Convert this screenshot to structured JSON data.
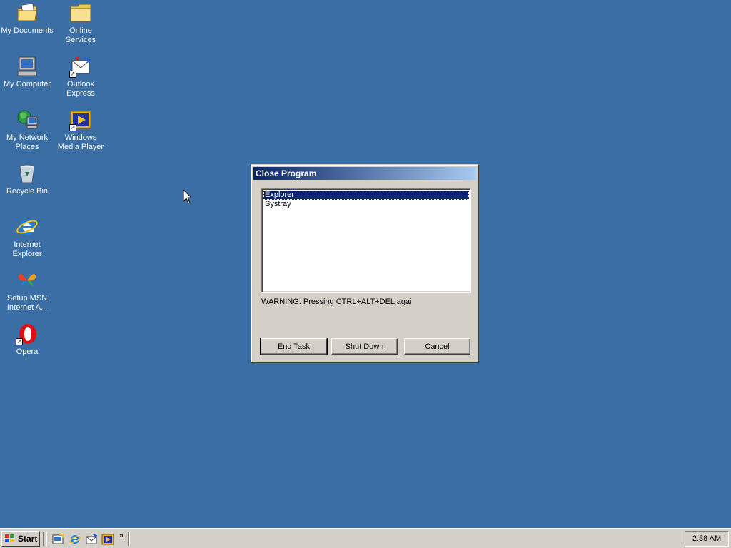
{
  "desktop": {
    "icons": [
      {
        "label": "My Documents",
        "icon": "my-documents-icon"
      },
      {
        "label": "Online Services",
        "icon": "folder-icon"
      },
      {
        "label": "My Computer",
        "icon": "my-computer-icon"
      },
      {
        "label": "Outlook Express",
        "icon": "outlook-express-icon"
      },
      {
        "label": "My Network Places",
        "icon": "network-places-icon"
      },
      {
        "label": "Windows Media Player",
        "icon": "media-player-icon"
      },
      {
        "label": "Recycle Bin",
        "icon": "recycle-bin-icon"
      },
      {
        "label": "Internet Explorer",
        "icon": "internet-explorer-icon"
      },
      {
        "label": "Setup MSN Internet A...",
        "icon": "msn-butterfly-icon"
      },
      {
        "label": "Opera",
        "icon": "opera-icon"
      }
    ]
  },
  "dialog": {
    "title": "Close Program",
    "items": [
      "Explorer",
      "Systray"
    ],
    "selected": "Explorer",
    "warning": "WARNING: Pressing CTRL+ALT+DEL agai",
    "buttons": {
      "end_task": "End Task",
      "shut_down": "Shut Down",
      "cancel": "Cancel"
    }
  },
  "taskbar": {
    "start_label": "Start",
    "quick_launch": [
      "show-desktop-icon",
      "internet-explorer-icon",
      "outlook-express-icon",
      "media-player-icon"
    ],
    "chevron": "»",
    "clock": "2:38 AM"
  },
  "colors": {
    "desktop": "#3a6ea5",
    "face": "#d4d0c8",
    "title_start": "#0a246a",
    "title_end": "#a6caf0"
  }
}
